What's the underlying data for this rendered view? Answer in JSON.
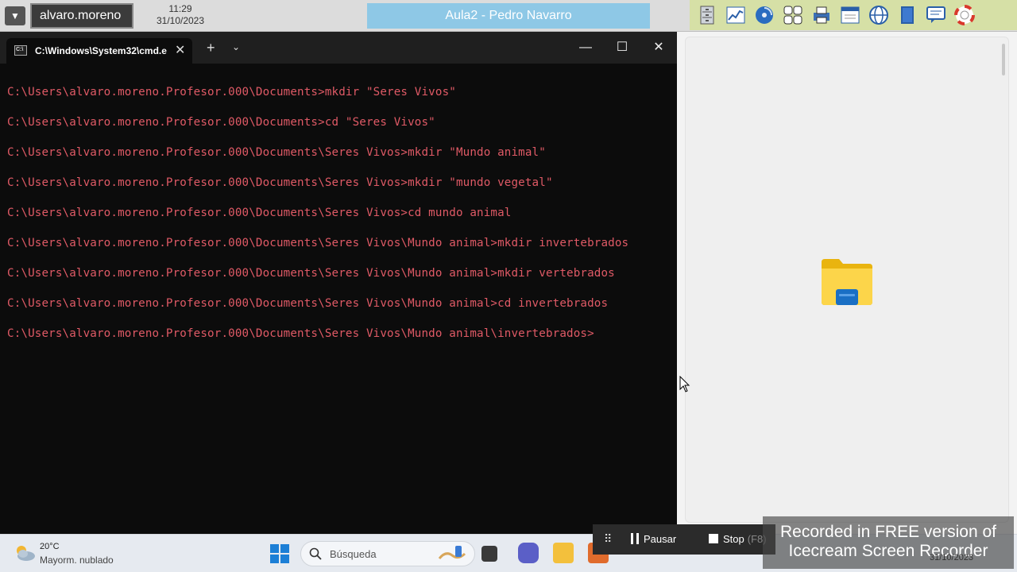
{
  "topbar": {
    "user_name": "alvaro.moreno",
    "clock_time": "11:29",
    "clock_date": "31/10/2023",
    "session_title": "Aula2 - Pedro Navarro",
    "tools": [
      "drawer-icon",
      "chart-icon",
      "disc-icon",
      "keyboard-icon",
      "printer-icon",
      "window-icon",
      "globe-icon",
      "book-icon",
      "chat-icon",
      "lifebuoy-icon"
    ]
  },
  "cmd": {
    "tab_title": "C:\\Windows\\System32\\cmd.e",
    "tab_close": "✕",
    "new_tab": "+",
    "dropdown": "⌄",
    "minimize": "—",
    "maximize": "☐",
    "close": "✕",
    "lines": [
      "C:\\Users\\alvaro.moreno.Profesor.000\\Documents>mkdir \"Seres Vivos\"",
      "C:\\Users\\alvaro.moreno.Profesor.000\\Documents>cd \"Seres Vivos\"",
      "C:\\Users\\alvaro.moreno.Profesor.000\\Documents\\Seres Vivos>mkdir \"Mundo animal\"",
      "C:\\Users\\alvaro.moreno.Profesor.000\\Documents\\Seres Vivos>mkdir \"mundo vegetal\"",
      "C:\\Users\\alvaro.moreno.Profesor.000\\Documents\\Seres Vivos>cd mundo animal",
      "C:\\Users\\alvaro.moreno.Profesor.000\\Documents\\Seres Vivos\\Mundo animal>mkdir invertebrados",
      "C:\\Users\\alvaro.moreno.Profesor.000\\Documents\\Seres Vivos\\Mundo animal>mkdir vertebrados",
      "C:\\Users\\alvaro.moreno.Profesor.000\\Documents\\Seres Vivos\\Mundo animal>cd invertebrados",
      "C:\\Users\\alvaro.moreno.Profesor.000\\Documents\\Seres Vivos\\Mundo animal\\invertebrados>"
    ],
    "text_color": "#e05a66"
  },
  "taskbar": {
    "weather_temp": "20°C",
    "weather_desc": "Mayorm. nublado",
    "search_placeholder": "Búsqueda",
    "tray_date": "31/10/2023"
  },
  "recorder": {
    "pause_label": "Pausar",
    "stop_label": "Stop",
    "stop_key": "(F8)",
    "watermark_line1": "Recorded in FREE version of",
    "watermark_line2": "Icecream    Screen    Recorder"
  }
}
